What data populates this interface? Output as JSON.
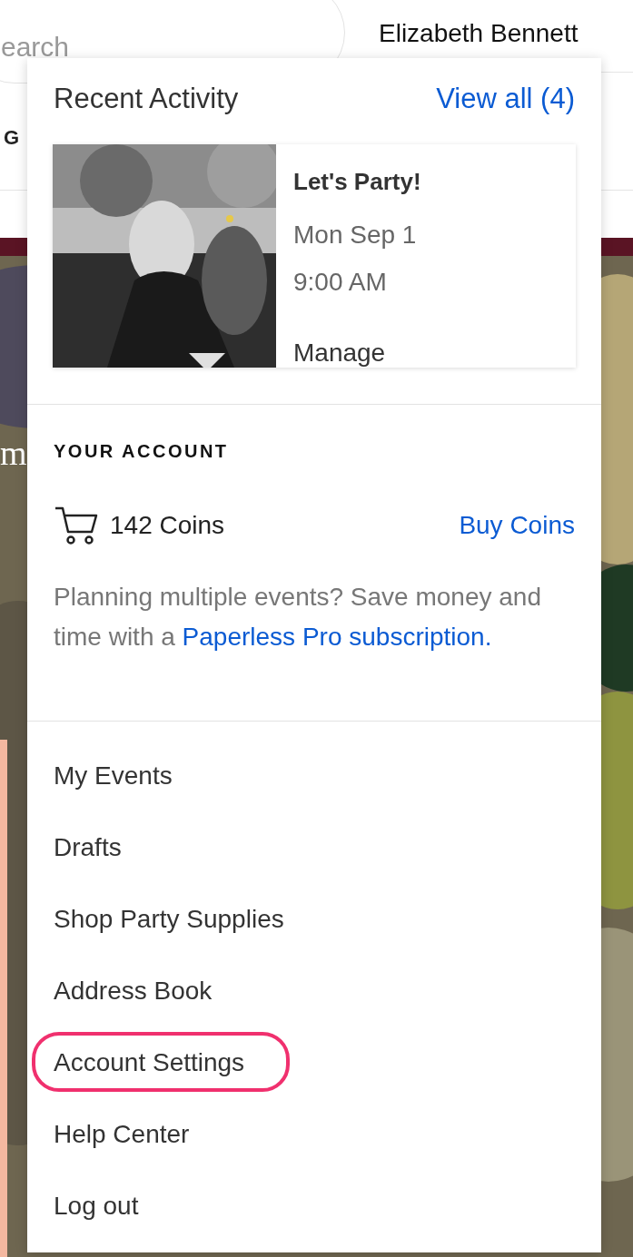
{
  "header": {
    "search": {
      "placeholder": "earch"
    },
    "user_name": "Elizabeth Bennett"
  },
  "nav": [
    "G"
  ],
  "hero": {
    "heading": "m"
  },
  "dropdown": {
    "recent_activity": {
      "title": "Recent Activity",
      "view_all": "View all (4)",
      "events": [
        {
          "title": "Let's Party!",
          "date": "Mon Sep 1",
          "time": "9:00 AM",
          "action": "Manage",
          "kind": "picture"
        }
      ]
    },
    "account": {
      "heading": "YOUR ACCOUNT",
      "coins": "142 Coins",
      "buy": "Buy Coins",
      "promo_text": "Planning multiple events? Save money and time with a",
      "promo_link": "Paperless Pro subscription."
    },
    "menu": [
      {
        "label": "My Events",
        "highlighted": false
      },
      {
        "label": "Drafts",
        "highlighted": false
      },
      {
        "label": "Shop Party Supplies",
        "highlighted": false
      },
      {
        "label": "Address Book",
        "highlighted": false
      },
      {
        "label": "Account Settings",
        "highlighted": true
      },
      {
        "label": "Help Center",
        "highlighted": false
      },
      {
        "label": "Log out",
        "highlighted": false
      }
    ]
  }
}
